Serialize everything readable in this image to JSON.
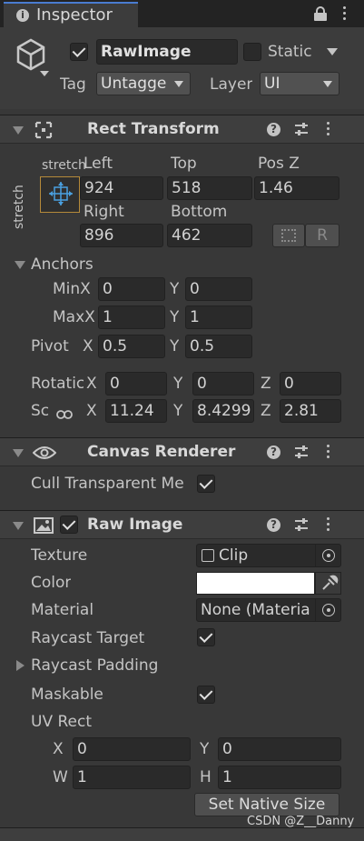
{
  "tab": {
    "title": "Inspector"
  },
  "object": {
    "name": "RawImage",
    "active": true,
    "static_label": "Static",
    "tag_label": "Tag",
    "tag_value": "Untagge",
    "layer_label": "Layer",
    "layer_value": "UI"
  },
  "rect_transform": {
    "title": "Rect Transform",
    "stretch_top": "stretch",
    "stretch_side": "stretch",
    "left_label": "Left",
    "top_label": "Top",
    "posz_label": "Pos Z",
    "left": "924",
    "top": "518",
    "posz": "1.46",
    "right_label": "Right",
    "bottom_label": "Bottom",
    "right": "896",
    "bottom": "462",
    "r_button": "R",
    "anchors_label": "Anchors",
    "min_label": "MinX",
    "min_x": "0",
    "min_y_label": "Y",
    "min_y": "0",
    "max_label": "MaxX",
    "max_x": "1",
    "max_y_label": "Y",
    "max_y": "1",
    "pivot_label": "Pivot",
    "pivot_x_label": "X",
    "pivot_x": "0.5",
    "pivot_y_label": "Y",
    "pivot_y": "0.5",
    "rotation_label": "Rotatic",
    "rot_x_label": "X",
    "rot_x": "0",
    "rot_y_label": "Y",
    "rot_y": "0",
    "rot_z_label": "Z",
    "rot_z": "0",
    "scale_label": "Sc",
    "scale_x_label": "X",
    "scale_x": "11.24",
    "scale_y_label": "Y",
    "scale_y": "8.4299",
    "scale_z_label": "Z",
    "scale_z": "2.81"
  },
  "canvas_renderer": {
    "title": "Canvas Renderer",
    "cull_label": "Cull Transparent Me",
    "cull": true
  },
  "raw_image": {
    "title": "Raw Image",
    "enabled": true,
    "texture_label": "Texture",
    "texture_value": "Clip",
    "color_label": "Color",
    "color_value": "#ffffff",
    "material_label": "Material",
    "material_value": "None (Materia",
    "raycast_target_label": "Raycast Target",
    "raycast_target": true,
    "raycast_padding_label": "Raycast Padding",
    "maskable_label": "Maskable",
    "maskable": true,
    "uv_rect_label": "UV Rect",
    "uv_x_label": "X",
    "uv_x": "0",
    "uv_y_label": "Y",
    "uv_y": "0",
    "uv_w_label": "W",
    "uv_w": "1",
    "uv_h_label": "H",
    "uv_h": "1",
    "native_size_button": "Set Native Size"
  },
  "watermark": "CSDN @Z__Danny"
}
